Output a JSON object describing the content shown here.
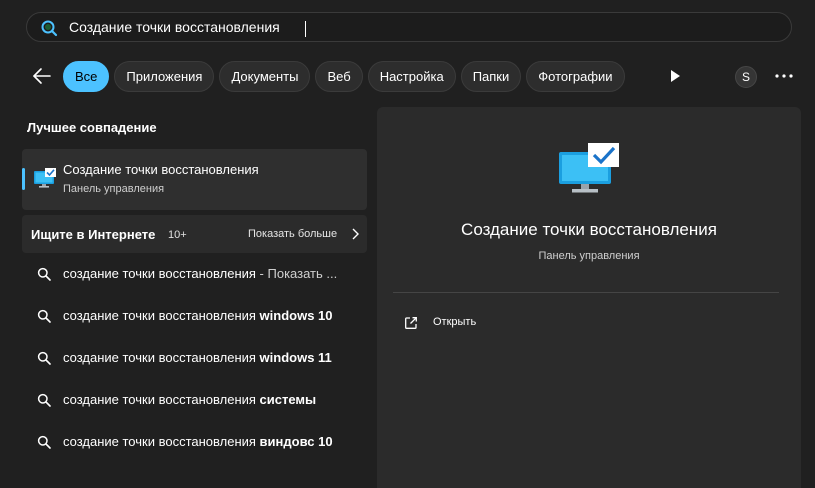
{
  "search": {
    "value": "Создание точки восстановления",
    "icon": "search-icon"
  },
  "filters": {
    "items": [
      {
        "label": "Все",
        "active": true
      },
      {
        "label": "Приложения",
        "active": false
      },
      {
        "label": "Документы",
        "active": false
      },
      {
        "label": "Веб",
        "active": false
      },
      {
        "label": "Настройка",
        "active": false
      },
      {
        "label": "Папки",
        "active": false
      },
      {
        "label": "Фотографии",
        "active": false
      }
    ],
    "avatar_letter": "S"
  },
  "best_match": {
    "heading": "Лучшее совпадение",
    "title": "Создание точки восстановления",
    "subtitle": "Панель управления",
    "icon": "system-restore-icon"
  },
  "web": {
    "heading": "Ищите в Интернете",
    "count": "10+",
    "more_label": "Показать больше"
  },
  "suggestions": [
    {
      "prefix": "создание точки восстановления",
      "bold": "",
      "rest": " - Показать ..."
    },
    {
      "prefix": "создание точки восстановления ",
      "bold": "windows 10",
      "rest": ""
    },
    {
      "prefix": "создание точки восстановления ",
      "bold": "windows 11",
      "rest": ""
    },
    {
      "prefix": "создание точки восстановления ",
      "bold": "системы",
      "rest": ""
    },
    {
      "prefix": "создание точки восстановления ",
      "bold": "виндовс 10",
      "rest": ""
    }
  ],
  "preview": {
    "title": "Создание точки восстановления",
    "subtitle": "Панель управления",
    "open_label": "Открыть"
  },
  "colors": {
    "accent": "#4cc2ff",
    "background": "#202020",
    "panel": "#2b2b2b",
    "card": "#2f2f2f"
  }
}
